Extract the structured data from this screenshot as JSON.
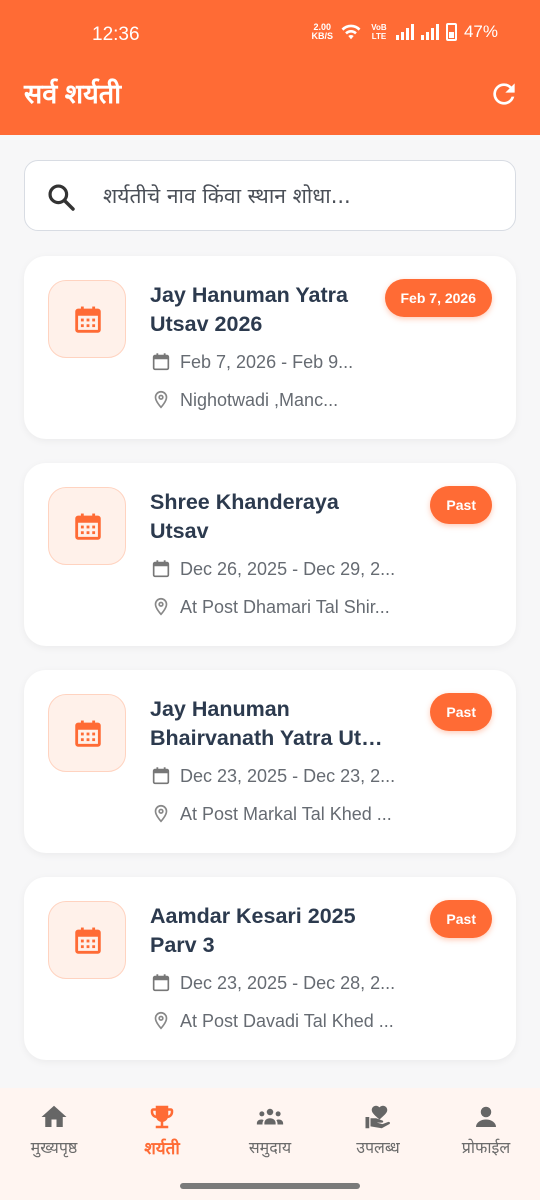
{
  "status_bar": {
    "time": "12:36",
    "net_speed": "2.00",
    "net_unit": "KB/S",
    "volte": "VoB LTE",
    "battery": "47%"
  },
  "header": {
    "title": "सर्व शर्यती",
    "refresh_icon": "refresh-icon"
  },
  "search": {
    "placeholder": "शर्यतीचे नाव किंवा स्थान शोधा..."
  },
  "events": [
    {
      "title_line1": "Jay Hanuman Yatra",
      "title_line2": "Utsav 2026",
      "badge": "Feb 7, 2026",
      "date_range": "Feb 7, 2026 - Feb 9...",
      "location": "Nighotwadi ,Manc..."
    },
    {
      "title_line1": "Shree Khanderaya",
      "title_line2": "Utsav",
      "badge": "Past",
      "date_range": "Dec 26, 2025 - Dec 29, 2...",
      "location": "At Post Dhamari Tal Shir..."
    },
    {
      "title_line1": "Jay Hanuman",
      "title_line2": "Bhairvanath Yatra Uts...",
      "badge": "Past",
      "date_range": "Dec 23, 2025 - Dec 23, 2...",
      "location": "At Post Markal Tal Khed ..."
    },
    {
      "title_line1": "Aamdar Kesari 2025",
      "title_line2": "Parv 3",
      "badge": "Past",
      "date_range": "Dec 23, 2025 - Dec 28, 2...",
      "location": "At Post Davadi Tal Khed ..."
    }
  ],
  "bottom_nav": [
    {
      "label": "मुख्यपृष्ठ",
      "icon": "home-icon",
      "active": false
    },
    {
      "label": "शर्यती",
      "icon": "trophy-icon",
      "active": true
    },
    {
      "label": "समुदाय",
      "icon": "groups-icon",
      "active": false
    },
    {
      "label": "उपलब्ध",
      "icon": "volunteer-icon",
      "active": false
    },
    {
      "label": "प्रोफाईल",
      "icon": "person-icon",
      "active": false
    }
  ],
  "colors": {
    "accent": "#ff6b35",
    "nav_inactive": "#6b6b6b",
    "title_text": "#2c3a4e"
  }
}
